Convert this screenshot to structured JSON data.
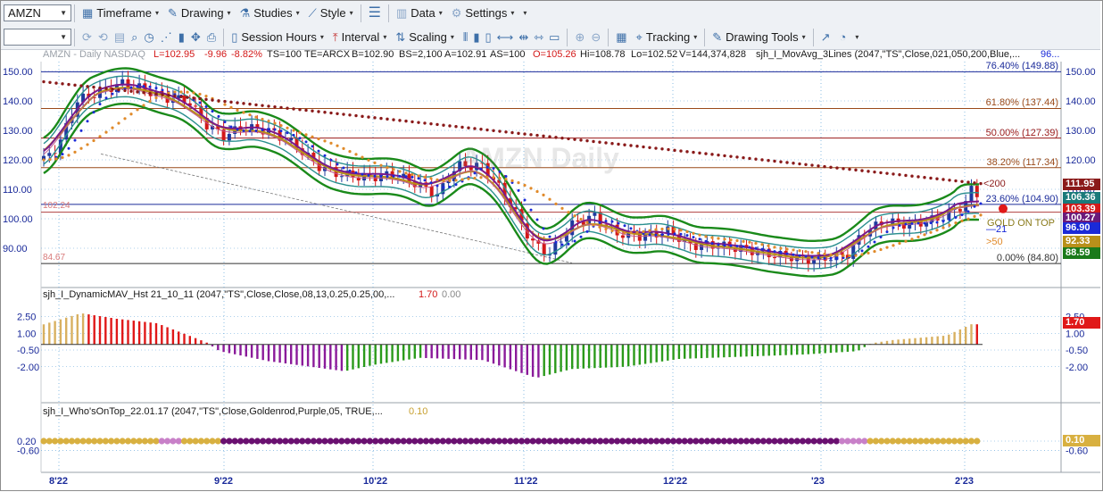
{
  "toolbar1": {
    "symbol": "AMZN",
    "timeframe": "Timeframe",
    "drawing": "Drawing",
    "studies": "Studies",
    "style": "Style",
    "data": "Data",
    "settings": "Settings"
  },
  "toolbar2": {
    "session_hours": "Session Hours",
    "interval": "Interval",
    "scaling": "Scaling",
    "tracking": "Tracking",
    "drawing_tools": "Drawing Tools"
  },
  "header": {
    "symbol_line": "AMZN - Daily  NASDAQ",
    "L": "L=102.95",
    "chg": "-9.96",
    "pct": "-8.82%",
    "ts": "TS=100",
    "te": "TE=ARCX",
    "b": "B=102.90",
    "bs": "BS=2,100",
    "a": "A=102.91",
    "as": "AS=100",
    "o": "O=105.26",
    "hi": "Hi=108.78",
    "lo": "Lo=102.52",
    "v": "V=144,374,828",
    "study": "sjh_I_MovAvg_3Lines (2047,\"TS\",Close,021,050,200,Blue,...",
    "study_val": "96..."
  },
  "watermark": "AMZN Daily",
  "colors": {
    "up": "#1f3a9e",
    "down": "#d31818",
    "ma_green": "#1a8a1a",
    "ma_teal": "#2a8f8f",
    "purple": "#7a1a8a",
    "gold": "#b8901a",
    "maroon": "#8a1a1a",
    "orange": "#e08a2a",
    "blue_dots": "#1a2ad8",
    "hist_gold": "#d8b060",
    "hist_red": "#e01818",
    "hist_purple": "#8a1a9a",
    "hist_green": "#2a9a1a",
    "dot_gold": "#d8b040",
    "dot_purple": "#6a1070"
  },
  "price_axis": [
    "150.00",
    "140.00",
    "130.00",
    "120.00",
    "110.00",
    "100.00",
    "90.00"
  ],
  "fib_levels": [
    {
      "label": "76.40% (149.88)",
      "value": 149.88,
      "color": "#1a2a9a"
    },
    {
      "label": "61.80% (137.44)",
      "value": 137.44,
      "color": "#9a4a1a"
    },
    {
      "label": "50.00% (127.39)",
      "value": 127.39,
      "color": "#9a1a1a"
    },
    {
      "label": "38.20% (117.34)",
      "value": 117.34,
      "color": "#9a4a1a"
    },
    {
      "label": "23.60% (104.90)",
      "value": 104.9,
      "color": "#1a2a9a"
    },
    {
      "label": "0.00% (84.80)",
      "value": 84.8,
      "color": "#333333"
    }
  ],
  "left_labels": {
    "hi_ref": "102.24",
    "lo_ref": "84.67"
  },
  "value_boxes": [
    {
      "text": "111.95",
      "color": "#8a1a1a",
      "price": 111.95
    },
    {
      "text": "106.36",
      "color": "#1a7a7a",
      "price": 107.2
    },
    {
      "text": "103.39",
      "color": "#d31818",
      "price": 103.39
    },
    {
      "text": "100.27",
      "color": "#6a1a7a",
      "price": 100.27
    },
    {
      "text": "96.90",
      "color": "#1a2ad8",
      "price": 96.9
    },
    {
      "text": "92.33",
      "color": "#b8901a",
      "price": 92.33
    },
    {
      "text": "88.59",
      "color": "#1a7a1a",
      "price": 88.59
    }
  ],
  "line_labels": {
    "ma200": "<200",
    "gold_on_top": "GOLD ON TOP",
    "ma21": "21",
    "ma50": ">50"
  },
  "panel2": {
    "title": "sjh_I_DynamicMAV_Hst 21_10_11 (2047,\"TS\",Close,Close,08,13,0.25,0.25,00,...",
    "v1": "1.70",
    "v2": "0.00",
    "axis": [
      "2.50",
      "1.00",
      "-0.50",
      "-2.00"
    ],
    "box": "1.70"
  },
  "panel3": {
    "title": "sjh_I_Who'sOnTop_22.01.17 (2047,\"TS\",Close,Goldenrod,Purple,05, TRUE,...",
    "v1": "0.10",
    "axis": [
      "0.20",
      "-0.60"
    ],
    "box": "0.10"
  },
  "time_axis": [
    "8'22",
    "9'22",
    "10'22",
    "11'22",
    "12'22",
    "'23",
    "2'23"
  ]
}
